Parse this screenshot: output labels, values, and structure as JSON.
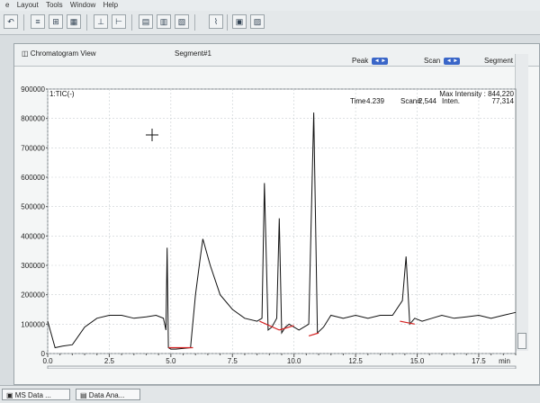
{
  "menu": {
    "items": [
      "e",
      "Layout",
      "Tools",
      "Window",
      "Help"
    ]
  },
  "toolbar": {
    "icons": [
      "undo-icon",
      "list-icon",
      "grid-icon",
      "chart-icon",
      "baseline-icon",
      "peak-icon",
      "calc-icon",
      "table-icon",
      "report-icon",
      "image-icon"
    ]
  },
  "window": {
    "title": "Chromatogram View",
    "segment_label": "Segment#1",
    "peak_label": "Peak",
    "scan_label": "Scan",
    "segment_right_label": "Segment",
    "arrow_glyph": "◄ ►"
  },
  "readout": {
    "trace_label": "1:TIC(-)",
    "max_intensity": "Max Intensity : 844,220",
    "time_label": "Time",
    "time_value": "4.239",
    "scan_label": "Scan#",
    "scan_value": "2,544",
    "inten_label": "Inten.",
    "inten_value": "77,314"
  },
  "taskbar": {
    "tab1": "MS Data ...",
    "tab2": "Data Ana..."
  },
  "chart_data": {
    "type": "line",
    "title": "",
    "xlabel": "min",
    "ylabel": "",
    "xlim": [
      0,
      19
    ],
    "ylim": [
      0,
      900000
    ],
    "x_ticks": [
      0.0,
      2.5,
      5.0,
      7.5,
      10.0,
      12.5,
      15.0,
      17.5
    ],
    "x_tick_labels": [
      "0.0",
      "2.5",
      "5.0",
      "7.5",
      "10.0",
      "12.5",
      "15.0",
      "17.5",
      "min"
    ],
    "y_ticks": [
      0,
      100000,
      200000,
      300000,
      400000,
      500000,
      600000,
      700000,
      800000,
      900000
    ],
    "y_tick_labels": [
      "0",
      "100000",
      "200000",
      "300000",
      "400000",
      "500000",
      "600000",
      "700000",
      "800000",
      "900000"
    ],
    "grid": true,
    "series_color": "#111111",
    "baseline_color": "#d32020",
    "series": [
      {
        "name": "1:TIC(-)",
        "x": [
          0.0,
          0.3,
          0.6,
          1.0,
          1.5,
          2.0,
          2.5,
          3.0,
          3.5,
          4.0,
          4.4,
          4.7,
          4.8,
          4.85,
          4.9,
          5.0,
          5.2,
          5.8,
          6.0,
          6.2,
          6.3,
          6.6,
          7.0,
          7.5,
          8.0,
          8.5,
          8.7,
          8.8,
          8.95,
          9.1,
          9.3,
          9.4,
          9.5,
          9.65,
          9.8,
          10.2,
          10.6,
          10.8,
          10.95,
          11.2,
          11.5,
          12.0,
          12.5,
          13.0,
          13.5,
          14.0,
          14.4,
          14.55,
          14.7,
          14.9,
          15.2,
          15.6,
          16.0,
          16.5,
          17.0,
          17.5,
          18.0,
          18.5,
          19.0
        ],
        "y": [
          110000,
          20000,
          25000,
          30000,
          90000,
          120000,
          130000,
          130000,
          120000,
          125000,
          130000,
          120000,
          80000,
          360000,
          20000,
          15000,
          15000,
          20000,
          200000,
          330000,
          390000,
          300000,
          200000,
          150000,
          120000,
          110000,
          120000,
          580000,
          80000,
          90000,
          120000,
          460000,
          70000,
          90000,
          100000,
          80000,
          100000,
          820000,
          70000,
          90000,
          130000,
          120000,
          130000,
          120000,
          130000,
          130000,
          180000,
          330000,
          100000,
          120000,
          110000,
          120000,
          130000,
          120000,
          125000,
          130000,
          120000,
          130000,
          140000
        ]
      }
    ],
    "baselines": [
      {
        "x": [
          4.9,
          5.9
        ],
        "y": [
          20000,
          20000
        ]
      },
      {
        "x": [
          8.6,
          9.4
        ],
        "y": [
          110000,
          80000
        ]
      },
      {
        "x": [
          9.4,
          10.0
        ],
        "y": [
          80000,
          95000
        ]
      },
      {
        "x": [
          10.6,
          11.0
        ],
        "y": [
          60000,
          70000
        ]
      },
      {
        "x": [
          14.3,
          14.9
        ],
        "y": [
          110000,
          100000
        ]
      }
    ]
  }
}
